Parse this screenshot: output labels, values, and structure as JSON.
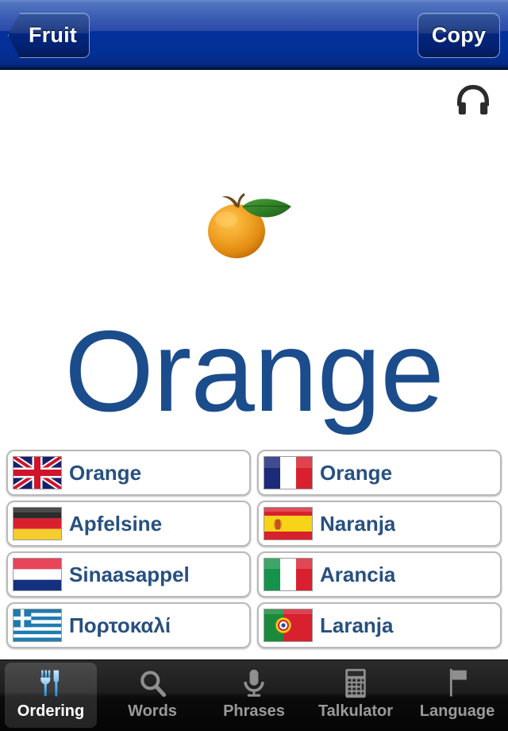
{
  "navbar": {
    "back_label": "Fruit",
    "action_label": "Copy"
  },
  "audio": {
    "icon": "headphones-icon"
  },
  "hero": {
    "icon": "orange-fruit-image",
    "alt": "Orange"
  },
  "word": {
    "title": "Orange",
    "color": "#1b4c8c"
  },
  "translations": [
    {
      "language": "English",
      "flag": "flag-uk",
      "word": "Orange"
    },
    {
      "language": "French",
      "flag": "flag-france",
      "word": "Orange"
    },
    {
      "language": "German",
      "flag": "flag-germany",
      "word": "Apfelsine"
    },
    {
      "language": "Spanish",
      "flag": "flag-spain",
      "word": "Naranja"
    },
    {
      "language": "Dutch",
      "flag": "flag-netherlands",
      "word": "Sinaasappel"
    },
    {
      "language": "Italian",
      "flag": "flag-italy",
      "word": "Arancia"
    },
    {
      "language": "Greek",
      "flag": "flag-greece",
      "word": "Πορτοκαλί"
    },
    {
      "language": "Portuguese",
      "flag": "flag-portugal",
      "word": "Laranja"
    }
  ],
  "tabs": [
    {
      "label": "Ordering",
      "icon": "fork-knife-icon",
      "active": true
    },
    {
      "label": "Words",
      "icon": "search-icon",
      "active": false
    },
    {
      "label": "Phrases",
      "icon": "microphone-icon",
      "active": false
    },
    {
      "label": "Talkulator",
      "icon": "calculator-icon",
      "active": false
    },
    {
      "label": "Language",
      "icon": "flag-icon",
      "active": false
    }
  ]
}
